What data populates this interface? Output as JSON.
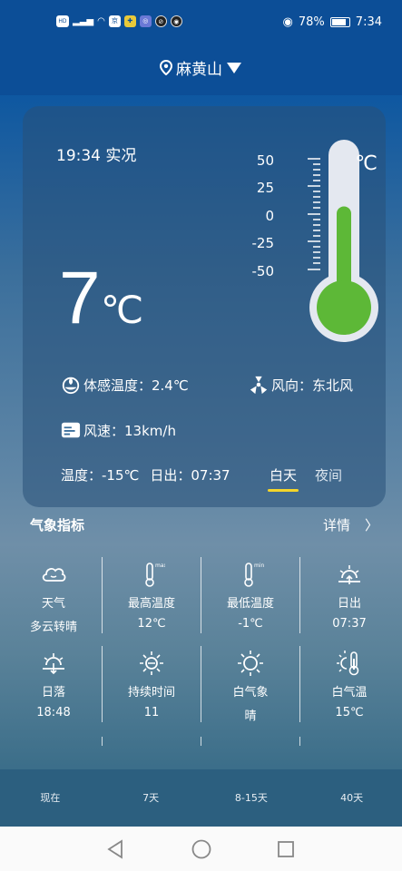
{
  "status_bar": {
    "left_chips": [
      "HD",
      "4G",
      "🛜",
      "京",
      "✚",
      "◎",
      "⊘",
      "◉"
    ],
    "battery": "78%",
    "time": "7:34"
  },
  "header": {
    "location": "麻黄山"
  },
  "current": {
    "time_label": "19:34 实况",
    "temperature": "7",
    "unit": "℃",
    "thermometer_scale": [
      "50",
      "25",
      "0",
      "-25",
      "-50"
    ],
    "thermometer_unit": "℃",
    "thermometer_value": 7,
    "feels_like": "体感温度：2.4℃",
    "wind_dir": "风向：东北风",
    "wind_speed": "风速：13km/h",
    "temp_low": "温度：-15℃",
    "sunrise": "日出：07:37",
    "day_tab": "白天",
    "night_tab": "夜间"
  },
  "indicators": {
    "title": "气象指标",
    "detail": "详情",
    "items": [
      {
        "icon": "cloud-icon",
        "label": "天气",
        "value": "多云转晴"
      },
      {
        "icon": "thermometer-max-icon",
        "label": "最高温度",
        "value": "12℃"
      },
      {
        "icon": "thermometer-min-icon",
        "label": "最低温度",
        "value": "-1℃"
      },
      {
        "icon": "sunrise-icon",
        "label": "日出",
        "value": "07:37"
      },
      {
        "icon": "sunset-icon",
        "label": "日落",
        "value": "18:48"
      },
      {
        "icon": "sun-duration-icon",
        "label": "持续时间",
        "value": "11"
      },
      {
        "icon": "sun-icon",
        "label": "白气象",
        "value": "晴"
      },
      {
        "icon": "sun-thermometer-icon",
        "label": "白气温",
        "value": "15℃"
      }
    ]
  },
  "bottom_nav": [
    "现在",
    "7天",
    "8-15天",
    "40天"
  ]
}
